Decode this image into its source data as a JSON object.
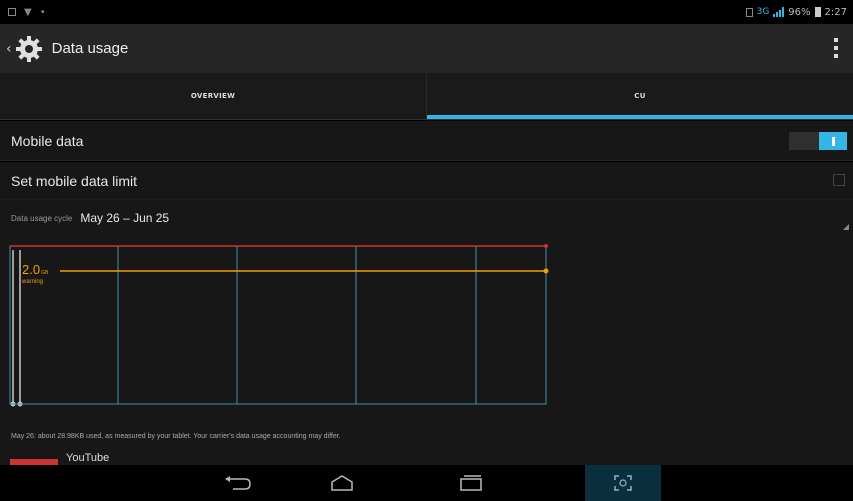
{
  "status_bar": {
    "network_type": "3G",
    "battery_percent": "96%",
    "time": "2:27"
  },
  "action_bar": {
    "title": "Data usage"
  },
  "tabs": [
    {
      "label": "OVERVIEW",
      "active": false
    },
    {
      "label": "CU",
      "active": true
    }
  ],
  "settings": {
    "mobile_data_label": "Mobile data",
    "mobile_data_on": true,
    "limit_label": "Set mobile data limit",
    "limit_checked": false,
    "cycle_label": "Data usage cycle",
    "cycle_value": "May 26 – Jun 25"
  },
  "chart": {
    "warning_value": "2.0",
    "warning_unit": "GB",
    "warning_label": "warning",
    "colors": {
      "limit": "#cc3333",
      "warning": "#f0a000",
      "grid": "#4a8fa8",
      "axis": "#c8c8c8"
    }
  },
  "summary_text": "May 26: about 28.98KB used, as measured by your tablet. Your carrier's data usage accounting may differ.",
  "app_row": {
    "name": "YouTube"
  },
  "nav_bar": {
    "icons": [
      "back-icon",
      "home-icon",
      "recent-apps-icon",
      "screenshot-icon"
    ]
  }
}
